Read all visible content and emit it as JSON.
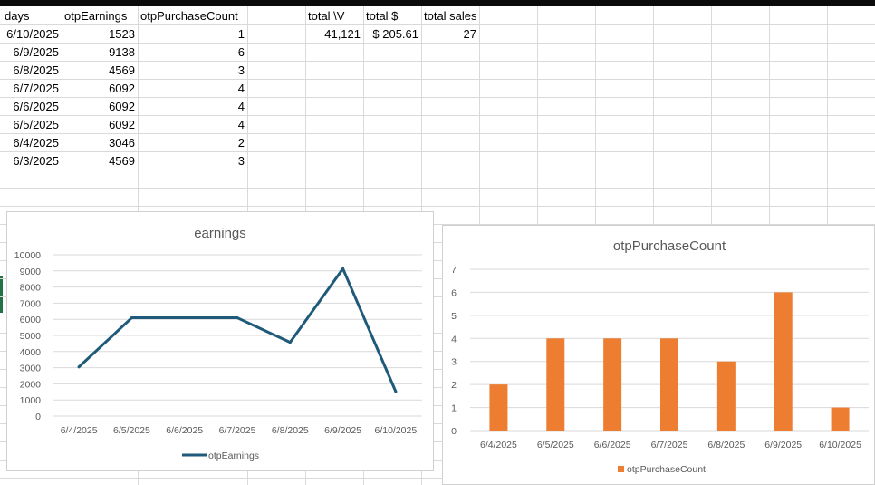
{
  "sheet": {
    "headers": {
      "days": "days",
      "earnings": "otpEarnings",
      "count": "otpPurchaseCount",
      "total_v": "total \\V",
      "total_dollar": "total $",
      "total_sales": "total sales"
    },
    "rows": [
      {
        "day": "6/10/2025",
        "earnings": "1523",
        "count": "1"
      },
      {
        "day": "6/9/2025",
        "earnings": "9138",
        "count": "6"
      },
      {
        "day": "6/8/2025",
        "earnings": "4569",
        "count": "3"
      },
      {
        "day": "6/7/2025",
        "earnings": "6092",
        "count": "4"
      },
      {
        "day": "6/6/2025",
        "earnings": "6092",
        "count": "4"
      },
      {
        "day": "6/5/2025",
        "earnings": "6092",
        "count": "4"
      },
      {
        "day": "6/4/2025",
        "earnings": "3046",
        "count": "2"
      },
      {
        "day": "6/3/2025",
        "earnings": "4569",
        "count": "3"
      }
    ],
    "totals": {
      "total_v": "41,121",
      "total_dollar": "$ 205.61",
      "total_sales": "27"
    }
  },
  "chart_data": [
    {
      "type": "line",
      "title": "earnings",
      "categories": [
        "6/4/2025",
        "6/5/2025",
        "6/6/2025",
        "6/7/2025",
        "6/8/2025",
        "6/9/2025",
        "6/10/2025"
      ],
      "series": [
        {
          "name": "otpEarnings",
          "values": [
            3046,
            6092,
            6092,
            6092,
            4569,
            9138,
            1523
          ],
          "color": "#1f5a7a"
        }
      ],
      "ylim": [
        0,
        10000
      ],
      "yticks": [
        0,
        1000,
        2000,
        3000,
        4000,
        5000,
        6000,
        7000,
        8000,
        9000,
        10000
      ],
      "grid": true,
      "legend": "bottom"
    },
    {
      "type": "bar",
      "title": "otpPurchaseCount",
      "categories": [
        "6/4/2025",
        "6/5/2025",
        "6/6/2025",
        "6/7/2025",
        "6/8/2025",
        "6/9/2025",
        "6/10/2025"
      ],
      "series": [
        {
          "name": "otpPurchaseCount",
          "values": [
            2,
            4,
            4,
            4,
            3,
            6,
            1
          ],
          "color": "#ed7d31"
        }
      ],
      "ylim": [
        0,
        7
      ],
      "yticks": [
        0,
        1,
        2,
        3,
        4,
        5,
        6,
        7
      ],
      "grid": true,
      "legend": "bottom"
    }
  ]
}
